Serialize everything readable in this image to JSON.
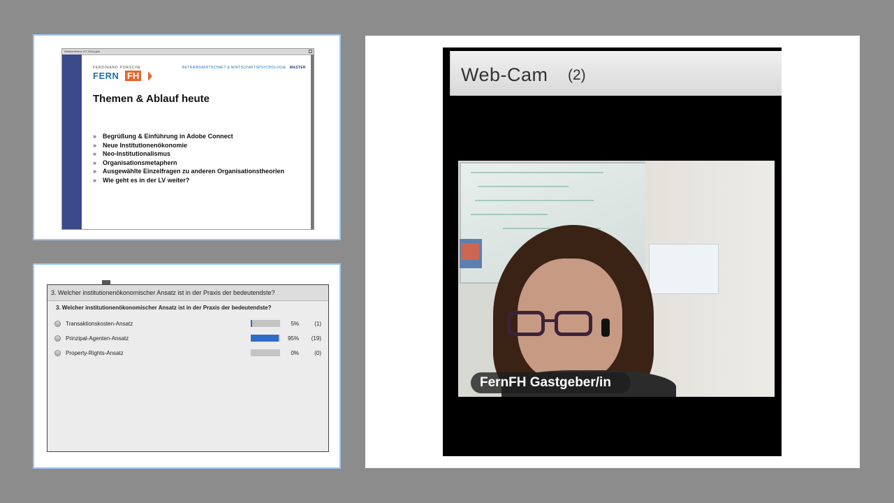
{
  "slide": {
    "window_title": "Webkonferenz GT 2014.pptx",
    "brand_top": "FERDINAND PORSCHE",
    "brand_fern": "FERN",
    "brand_fh": "FH",
    "dept": "BETRIEBSWIRTSCHAFT & WIRTSCHAFTSPSYCHOLOGIE",
    "dept_level": "MASTER",
    "heading": "Themen & Ablauf heute",
    "bullet_mark": "»",
    "bullets": [
      "Begrüßung & Einführung in Adobe Connect",
      "Neue Institutionenökonomie",
      "Neo-Institutionalismus",
      "Organisationsmetaphern",
      "Ausgewählte Einzelfragen zu anderen Organisationstheorien",
      "Wie geht es in der LV weiter?"
    ]
  },
  "poll": {
    "title": "3. Welcher institutionenökonomischer Ansatz ist in der Praxis der bedeutendste?",
    "question": "3. Welcher institutionenökonomischer Ansatz ist in der Praxis der bedeutendste?",
    "options": [
      {
        "label": "Transaktionskosten-Ansatz",
        "percent_text": "5%",
        "count_text": "(1)",
        "share": 0.05
      },
      {
        "label": "Prinzipal-Agenten-Ansatz",
        "percent_text": "95%",
        "count_text": "(19)",
        "share": 0.95
      },
      {
        "label": "Property-Rights-Ansatz",
        "percent_text": "0%",
        "count_text": "(0)",
        "share": 0.0
      }
    ],
    "bar_color": "#2e6cc6"
  },
  "webcam": {
    "title": "Web-Cam",
    "count": "(2)",
    "participant_name": "FernFH Gastgeber/in"
  },
  "colors": {
    "background": "#8c8c8c",
    "panel_border": "#9cc7f0",
    "brand_blue": "#1e6fb5",
    "brand_orange": "#e8642a"
  }
}
